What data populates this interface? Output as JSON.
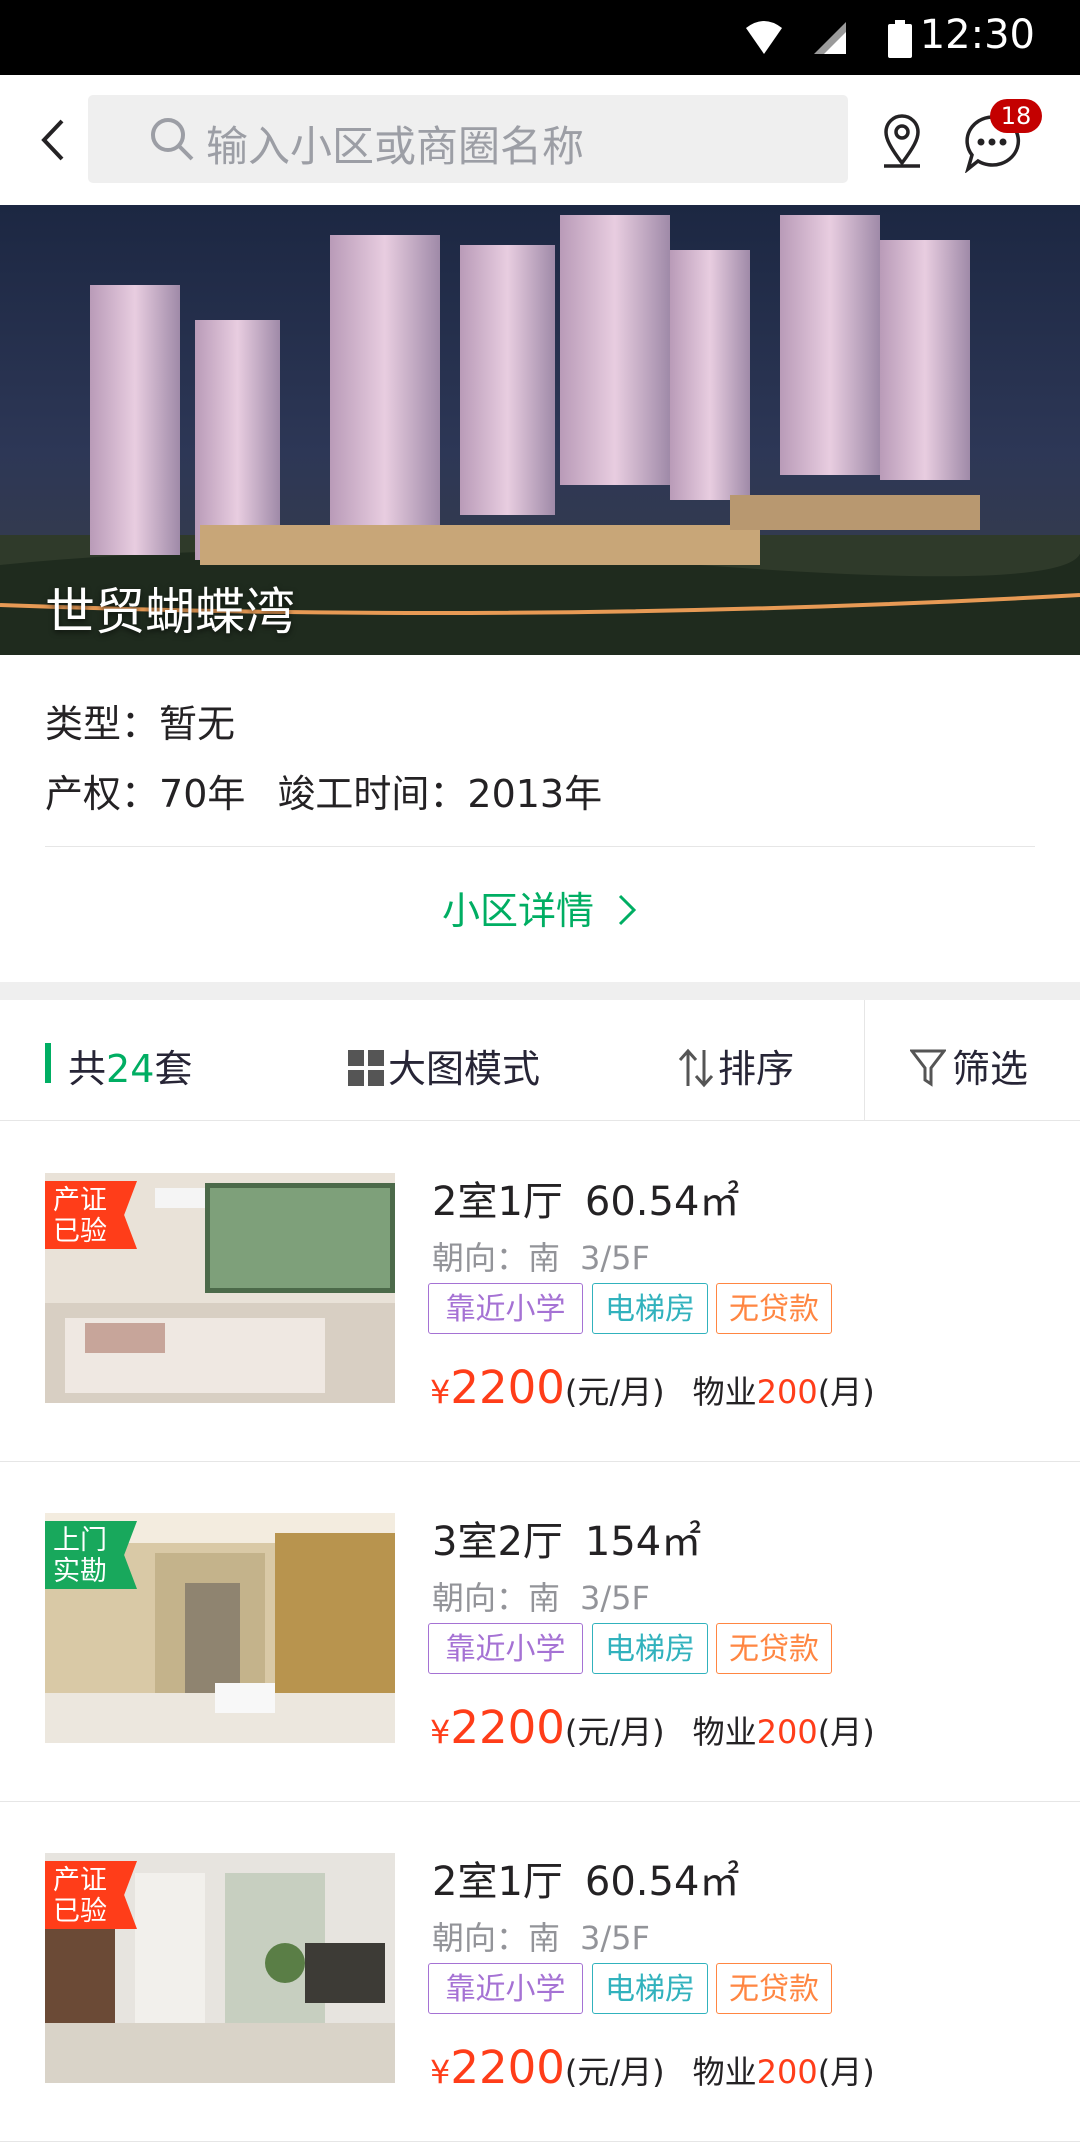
{
  "status_bar": {
    "time": "12:30"
  },
  "search": {
    "placeholder": "输入小区或商圈名称"
  },
  "header": {
    "badge_count": "18"
  },
  "hero": {
    "title": "世贸蝴蝶湾"
  },
  "info": {
    "type_label": "类型：",
    "type_value": "暂无",
    "rights_label": "产权：",
    "rights_value": "70年",
    "completion_label": "竣工时间：",
    "completion_value": "2013年"
  },
  "detail_link": {
    "label": "小区详情",
    "color": "#00AE63"
  },
  "toolbar": {
    "total_prefix": "共",
    "total_count": "24",
    "total_suffix": "套",
    "grid_mode": "大图模式",
    "sort": "排序",
    "filter": "筛选"
  },
  "listings": [
    {
      "badge": "产证\n已验",
      "badge_color": "#FF3D19",
      "layout": "2室1厅",
      "area": "60.54㎡",
      "facing": "朝向：南",
      "floor": "3/5F",
      "tags": [
        "靠近小学",
        "电梯房",
        "无贷款"
      ],
      "currency": "¥",
      "price": "2200",
      "price_unit": "(元/月)",
      "fee_label": "物业",
      "fee": "200",
      "fee_unit": "(月)"
    },
    {
      "badge": "上门\n实勘",
      "badge_color": "#18a85c",
      "layout": "3室2厅",
      "area": "154㎡",
      "facing": "朝向：南",
      "floor": "3/5F",
      "tags": [
        "靠近小学",
        "电梯房",
        "无贷款"
      ],
      "currency": "¥",
      "price": "2200",
      "price_unit": "(元/月)",
      "fee_label": "物业",
      "fee": "200",
      "fee_unit": "(月)"
    },
    {
      "badge": "产证\n已验",
      "badge_color": "#FF3D19",
      "layout": "2室1厅",
      "area": "60.54㎡",
      "facing": "朝向：南",
      "floor": "3/5F",
      "tags": [
        "靠近小学",
        "电梯房",
        "无贷款"
      ],
      "currency": "¥",
      "price": "2200",
      "price_unit": "(元/月)",
      "fee_label": "物业",
      "fee": "200",
      "fee_unit": "(月)"
    }
  ]
}
